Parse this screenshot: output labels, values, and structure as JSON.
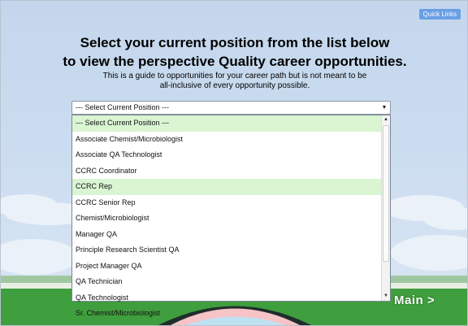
{
  "header": {
    "quick_links": "Quick Links",
    "title_line1": "Select your current position from the list below",
    "title_line2": "to view the perspective Quality career opportunities.",
    "subtitle_line1": "This is a guide to opportunities for your career path but is not meant to be",
    "subtitle_line2": "all-inclusive of every opportunity possible."
  },
  "dropdown": {
    "selected": "--- Select Current Position ---",
    "options": [
      "--- Select Current Position ---",
      "Associate Chemist/Microbiologist",
      "Associate QA Technologist",
      "CCRC Coordinator",
      "CCRC Rep",
      "CCRC Senior Rep",
      "Chemist/Microbiologist",
      "Manager QA",
      "Principle Research Scientist QA",
      "Project Manager QA",
      "QA Technician",
      "QA Technologist",
      "Sr. Chemist/Microbiologist"
    ]
  },
  "nav": {
    "main_label": "Main >"
  }
}
